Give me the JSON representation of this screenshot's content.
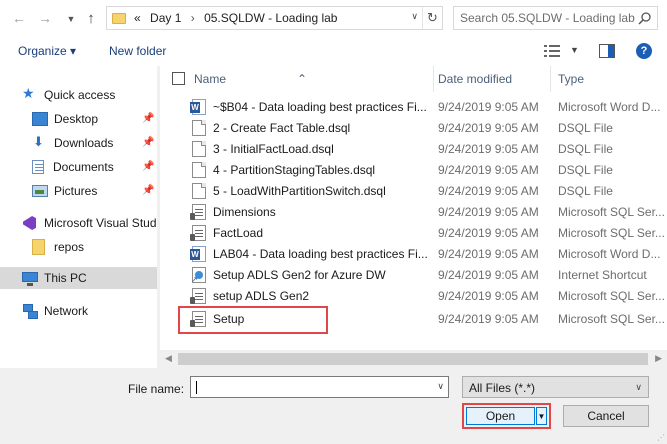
{
  "address": {
    "overflow": "«",
    "crumbs": [
      "Day 1",
      "05.SQLDW - Loading lab"
    ]
  },
  "search": {
    "placeholder": "Search 05.SQLDW - Loading lab"
  },
  "toolbar": {
    "organize_label": "Organize ▾",
    "new_folder_label": "New folder",
    "help_label": "?"
  },
  "nav": {
    "items": [
      {
        "label": "Quick access",
        "icon": "star-icon"
      },
      {
        "label": "Desktop",
        "icon": "desktop-icon",
        "pinned": true
      },
      {
        "label": "Downloads",
        "icon": "downloads-icon",
        "pinned": true
      },
      {
        "label": "Documents",
        "icon": "documents-icon",
        "pinned": true
      },
      {
        "label": "Pictures",
        "icon": "pictures-icon",
        "pinned": true
      },
      {
        "label": "Microsoft Visual Stud",
        "icon": "visual-studio-icon"
      },
      {
        "label": "repos",
        "icon": "folder-icon"
      },
      {
        "label": "This PC",
        "icon": "this-pc-icon",
        "selected": true
      },
      {
        "label": "Network",
        "icon": "network-icon"
      }
    ]
  },
  "columns": {
    "name": "Name",
    "date": "Date modified",
    "type": "Type"
  },
  "files": [
    {
      "name": "~$B04 - Data loading best practices Fi...",
      "date": "9/24/2019 9:05 AM",
      "type": "Microsoft Word D...",
      "icon": "word-icon"
    },
    {
      "name": "2 - Create Fact Table.dsql",
      "date": "9/24/2019 9:05 AM",
      "type": "DSQL File",
      "icon": "document-icon"
    },
    {
      "name": "3 - InitialFactLoad.dsql",
      "date": "9/24/2019 9:05 AM",
      "type": "DSQL File",
      "icon": "document-icon"
    },
    {
      "name": "4 - PartitionStagingTables.dsql",
      "date": "9/24/2019 9:05 AM",
      "type": "DSQL File",
      "icon": "document-icon"
    },
    {
      "name": "5 - LoadWithPartitionSwitch.dsql",
      "date": "9/24/2019 9:05 AM",
      "type": "DSQL File",
      "icon": "document-icon"
    },
    {
      "name": "Dimensions",
      "date": "9/24/2019 9:05 AM",
      "type": "Microsoft SQL Ser...",
      "icon": "sql-script-icon"
    },
    {
      "name": "FactLoad",
      "date": "9/24/2019 9:05 AM",
      "type": "Microsoft SQL Ser...",
      "icon": "sql-script-icon"
    },
    {
      "name": "LAB04 - Data loading best practices Fi...",
      "date": "9/24/2019 9:05 AM",
      "type": "Microsoft Word D...",
      "icon": "word-icon"
    },
    {
      "name": "Setup ADLS Gen2 for Azure DW",
      "date": "9/24/2019 9:05 AM",
      "type": "Internet Shortcut",
      "icon": "url-icon"
    },
    {
      "name": "setup ADLS Gen2",
      "date": "9/24/2019 9:05 AM",
      "type": "Microsoft SQL Ser...",
      "icon": "sql-script-icon"
    },
    {
      "name": "Setup",
      "date": "9/24/2019 9:05 AM",
      "type": "Microsoft SQL Ser...",
      "icon": "sql-script-icon"
    }
  ],
  "bottom": {
    "filename_label": "File name:",
    "filename_value": "",
    "filetype_value": "All Files (*.*)",
    "open_label": "Open",
    "cancel_label": "Cancel"
  },
  "colors": {
    "highlight": "#e0464a",
    "accent": "#0078d7",
    "selected_nav": "#d9d9d9"
  }
}
